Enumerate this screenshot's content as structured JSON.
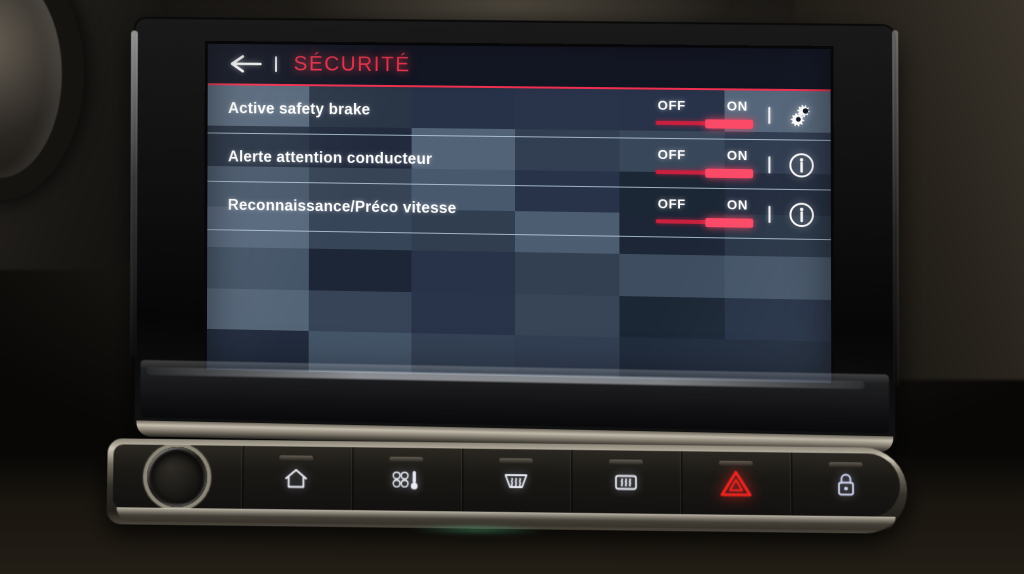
{
  "device": {
    "kind": "car-infotainment-touchscreen"
  },
  "screen": {
    "header": {
      "back_icon": "back-arrow-icon",
      "separator": "|",
      "title": "SÉCURITÉ",
      "title_color": "#f2364f",
      "underline_color": "#f0304f"
    },
    "rows": [
      {
        "label": "Active safety brake",
        "toggle": {
          "off_label": "OFF",
          "on_label": "ON",
          "state": "ON"
        },
        "separator": "|",
        "icon": "gears-settings-icon"
      },
      {
        "label": "Alerte attention conducteur",
        "toggle": {
          "off_label": "OFF",
          "on_label": "ON",
          "state": "ON"
        },
        "separator": "|",
        "icon": "info-circle-icon"
      },
      {
        "label": "Reconnaissance/Préco vitesse",
        "toggle": {
          "off_label": "OFF",
          "on_label": "ON",
          "state": "ON"
        },
        "separator": "|",
        "icon": "info-circle-icon"
      }
    ],
    "background": {
      "style": "mosaic-tiles",
      "palette": [
        "#2b3748",
        "#364356",
        "#222d3e",
        "#46566a",
        "#1d2736",
        "#3d4b5e",
        "#4e5e72",
        "#29344a",
        "#5a6a7e",
        "#323e52"
      ]
    }
  },
  "button_bar": {
    "knob": {
      "name": "rotary-volume-knob"
    },
    "buttons": [
      {
        "icon": "home-icon",
        "label": "Home"
      },
      {
        "icon": "climate-fan-icon",
        "label": "Climate"
      },
      {
        "icon": "windshield-defrost-icon",
        "label": "Front defrost"
      },
      {
        "icon": "rear-defrost-icon",
        "label": "Rear defrost"
      },
      {
        "icon": "hazard-warning-icon",
        "label": "Hazard lights",
        "color": "#e8241f"
      },
      {
        "icon": "door-lock-icon",
        "label": "Central locking"
      }
    ]
  },
  "colors": {
    "accent_red": "#f2364f",
    "toggle_track": "#c8203e",
    "toggle_knob": "#fb4a67",
    "row_separator": "#bacee2",
    "text_primary": "#ffffff",
    "hazard_red": "#e8241f"
  }
}
